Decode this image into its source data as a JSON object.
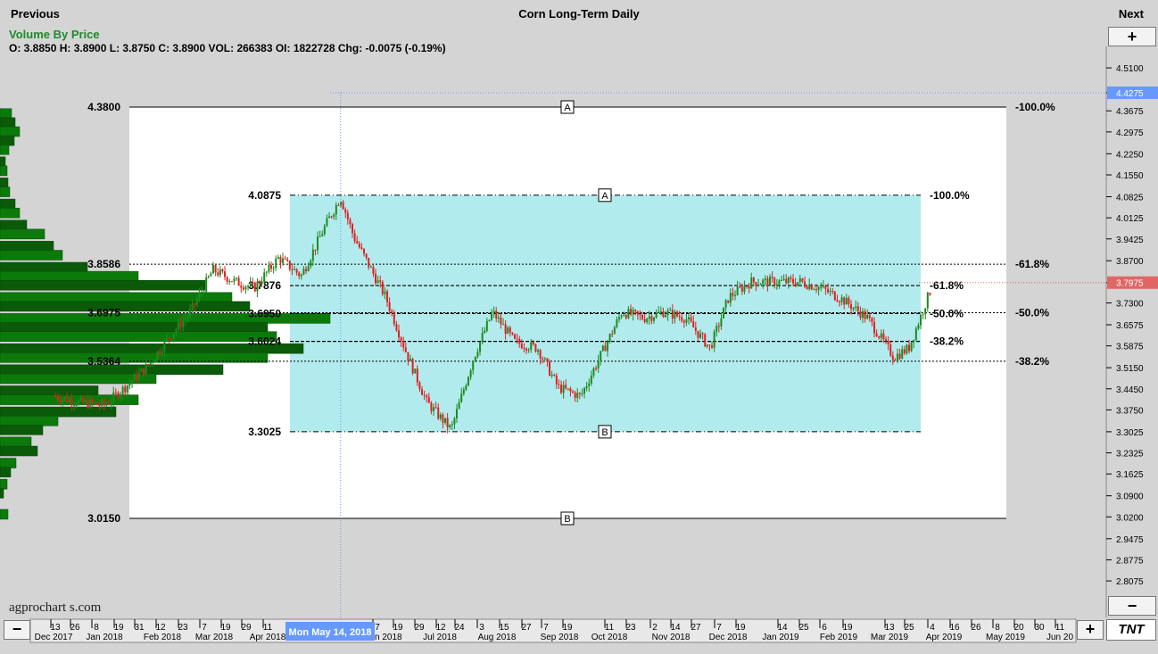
{
  "header": {
    "previous_label": "Previous",
    "next_label": "Next",
    "title": "Corn Long-Term Daily"
  },
  "study": {
    "label": "Volume By Price",
    "ohlc_text": "O: 3.8850  H: 3.8900  L: 3.8750  C: 3.8900 VOL: 266383 OI: 1822728 Chg: -0.0075 (-0.19%)"
  },
  "watermark": "agprochart s.com",
  "controls": {
    "zoom_in_label": "+",
    "zoom_out_label": "−",
    "scroll_left_label": "−",
    "scroll_right_label": "+",
    "logo_text": "TNT"
  },
  "colors": {
    "up": "#1e8a1e",
    "down": "#e02020",
    "fib_fill": "#b2ebee",
    "panel": "#ffffff",
    "background": "#d4d4d4",
    "volume_bar": "#0b7a0b",
    "volume_bar_dark": "#0a5a0a",
    "price_marker": "#e06666",
    "crosshair_marker": "#6699ff"
  },
  "chart_data": {
    "type": "candlestick",
    "title": "Corn Long-Term Daily",
    "study": "Volume By Price",
    "date_range": [
      "Dec 2017",
      "Jun 2019"
    ],
    "ylim": [
      2.7575,
      4.6
    ],
    "y_ticks": [
      "4.5100",
      "4.4275",
      "4.3675",
      "4.2975",
      "4.2250",
      "4.1550",
      "4.0825",
      "4.0125",
      "3.9425",
      "3.8700",
      "3.7975",
      "3.7300",
      "3.6575",
      "3.5875",
      "3.5150",
      "3.4450",
      "3.3750",
      "3.3025",
      "3.2325",
      "3.1625",
      "3.0900",
      "3.0200",
      "2.9475",
      "2.8775",
      "2.8075"
    ],
    "last_price": "3.7975",
    "cursor_price": "4.4275",
    "cursor_date": "Mon May 14, 2018",
    "x_axis": {
      "days": [
        "13",
        "26",
        "8",
        "19",
        "31",
        "12",
        "23",
        "7",
        "19",
        "29",
        "11",
        "7",
        "19",
        "29",
        "12",
        "24",
        "3",
        "15",
        "27",
        "7",
        "19",
        "11",
        "23",
        "2",
        "14",
        "27",
        "7",
        "19",
        "14",
        "25",
        "6",
        "19",
        "13",
        "25",
        "4",
        "16",
        "26",
        "8",
        "20",
        "30",
        "11"
      ],
      "months": [
        "Dec 2017",
        "Jan 2018",
        "Feb 2018",
        "Mar 2018",
        "Apr 2018",
        "Jun 2018",
        "Jul 2018",
        "Aug 2018",
        "Sep 2018",
        "Oct 2018",
        "Nov 2018",
        "Dec 2018",
        "Jan 2019",
        "Feb 2019",
        "Mar 2019",
        "Apr 2019",
        "May 2019",
        "Jun 20"
      ]
    },
    "outer_retracement": {
      "high": 4.38,
      "low": 3.015,
      "high_label": "4.3800",
      "low_label": "3.0150",
      "levels": [
        {
          "value": 3.8586,
          "label": "3.8586",
          "pct": "-61.8%"
        },
        {
          "value": 3.6975,
          "label": "3.6975",
          "pct": "-50.0%"
        },
        {
          "value": 3.5364,
          "label": "3.5364",
          "pct": "-38.2%"
        }
      ],
      "top_pct": "-100.0%",
      "point_a": "A",
      "point_b": "B"
    },
    "inner_retracement": {
      "high": 4.0875,
      "low": 3.3025,
      "high_label": "4.0875",
      "low_label": "3.3025",
      "levels": [
        {
          "value": 3.7876,
          "label": "3.7876",
          "pct": "-61.8%"
        },
        {
          "value": 3.695,
          "label": "3.6950",
          "pct": "-50.0%"
        },
        {
          "value": 3.6024,
          "label": "3.6024",
          "pct": "-38.2%"
        }
      ],
      "top_pct": "-100.0%",
      "point_a": "A",
      "point_b": "B"
    },
    "price_path": [
      {
        "date": "2017-12-13",
        "close": 3.42
      },
      {
        "date": "2017-12-26",
        "close": 3.4
      },
      {
        "date": "2018-01-08",
        "close": 3.39
      },
      {
        "date": "2018-01-19",
        "close": 3.45
      },
      {
        "date": "2018-01-31",
        "close": 3.52
      },
      {
        "date": "2018-02-12",
        "close": 3.62
      },
      {
        "date": "2018-02-23",
        "close": 3.7
      },
      {
        "date": "2018-03-07",
        "close": 3.84
      },
      {
        "date": "2018-03-19",
        "close": 3.8
      },
      {
        "date": "2018-03-29",
        "close": 3.78
      },
      {
        "date": "2018-04-11",
        "close": 3.88
      },
      {
        "date": "2018-04-23",
        "close": 3.82
      },
      {
        "date": "2018-05-07",
        "close": 4.0
      },
      {
        "date": "2018-05-14",
        "close": 4.08
      },
      {
        "date": "2018-05-21",
        "close": 3.95
      },
      {
        "date": "2018-06-07",
        "close": 3.75
      },
      {
        "date": "2018-06-19",
        "close": 3.55
      },
      {
        "date": "2018-06-29",
        "close": 3.4
      },
      {
        "date": "2018-07-12",
        "close": 3.31
      },
      {
        "date": "2018-07-24",
        "close": 3.55
      },
      {
        "date": "2018-08-03",
        "close": 3.7
      },
      {
        "date": "2018-08-15",
        "close": 3.6
      },
      {
        "date": "2018-08-27",
        "close": 3.58
      },
      {
        "date": "2018-09-07",
        "close": 3.45
      },
      {
        "date": "2018-09-19",
        "close": 3.42
      },
      {
        "date": "2018-10-11",
        "close": 3.7
      },
      {
        "date": "2018-10-23",
        "close": 3.68
      },
      {
        "date": "2018-11-02",
        "close": 3.7
      },
      {
        "date": "2018-11-14",
        "close": 3.68
      },
      {
        "date": "2018-11-27",
        "close": 3.58
      },
      {
        "date": "2018-12-07",
        "close": 3.75
      },
      {
        "date": "2018-12-19",
        "close": 3.8
      },
      {
        "date": "2019-01-14",
        "close": 3.8
      },
      {
        "date": "2019-01-25",
        "close": 3.78
      },
      {
        "date": "2019-02-06",
        "close": 3.74
      },
      {
        "date": "2019-02-19",
        "close": 3.68
      },
      {
        "date": "2019-03-05",
        "close": 3.55
      },
      {
        "date": "2019-03-13",
        "close": 3.58
      },
      {
        "date": "2019-03-25",
        "close": 3.78
      }
    ],
    "volume_profile": [
      {
        "price": 4.36,
        "volume": 13
      },
      {
        "price": 4.33,
        "volume": 17
      },
      {
        "price": 4.3,
        "volume": 22
      },
      {
        "price": 4.27,
        "volume": 16
      },
      {
        "price": 4.24,
        "volume": 10
      },
      {
        "price": 4.2,
        "volume": 6
      },
      {
        "price": 4.17,
        "volume": 8
      },
      {
        "price": 4.13,
        "volume": 9
      },
      {
        "price": 4.1,
        "volume": 11
      },
      {
        "price": 4.06,
        "volume": 17
      },
      {
        "price": 4.03,
        "volume": 22
      },
      {
        "price": 3.99,
        "volume": 30
      },
      {
        "price": 3.96,
        "volume": 50
      },
      {
        "price": 3.92,
        "volume": 60
      },
      {
        "price": 3.89,
        "volume": 70
      },
      {
        "price": 3.85,
        "volume": 98
      },
      {
        "price": 3.82,
        "volume": 155
      },
      {
        "price": 3.79,
        "volume": 230
      },
      {
        "price": 3.75,
        "volume": 260
      },
      {
        "price": 3.72,
        "volume": 280
      },
      {
        "price": 3.68,
        "volume": 370
      },
      {
        "price": 3.65,
        "volume": 300
      },
      {
        "price": 3.62,
        "volume": 310
      },
      {
        "price": 3.58,
        "volume": 340
      },
      {
        "price": 3.55,
        "volume": 300
      },
      {
        "price": 3.51,
        "volume": 250
      },
      {
        "price": 3.48,
        "volume": 175
      },
      {
        "price": 3.44,
        "volume": 110
      },
      {
        "price": 3.41,
        "volume": 155
      },
      {
        "price": 3.37,
        "volume": 130
      },
      {
        "price": 3.34,
        "volume": 65
      },
      {
        "price": 3.31,
        "volume": 48
      },
      {
        "price": 3.27,
        "volume": 35
      },
      {
        "price": 3.24,
        "volume": 42
      },
      {
        "price": 3.2,
        "volume": 18
      },
      {
        "price": 3.17,
        "volume": 12
      },
      {
        "price": 3.13,
        "volume": 8
      },
      {
        "price": 3.1,
        "volume": 4
      },
      {
        "price": 3.03,
        "volume": 9
      }
    ]
  }
}
